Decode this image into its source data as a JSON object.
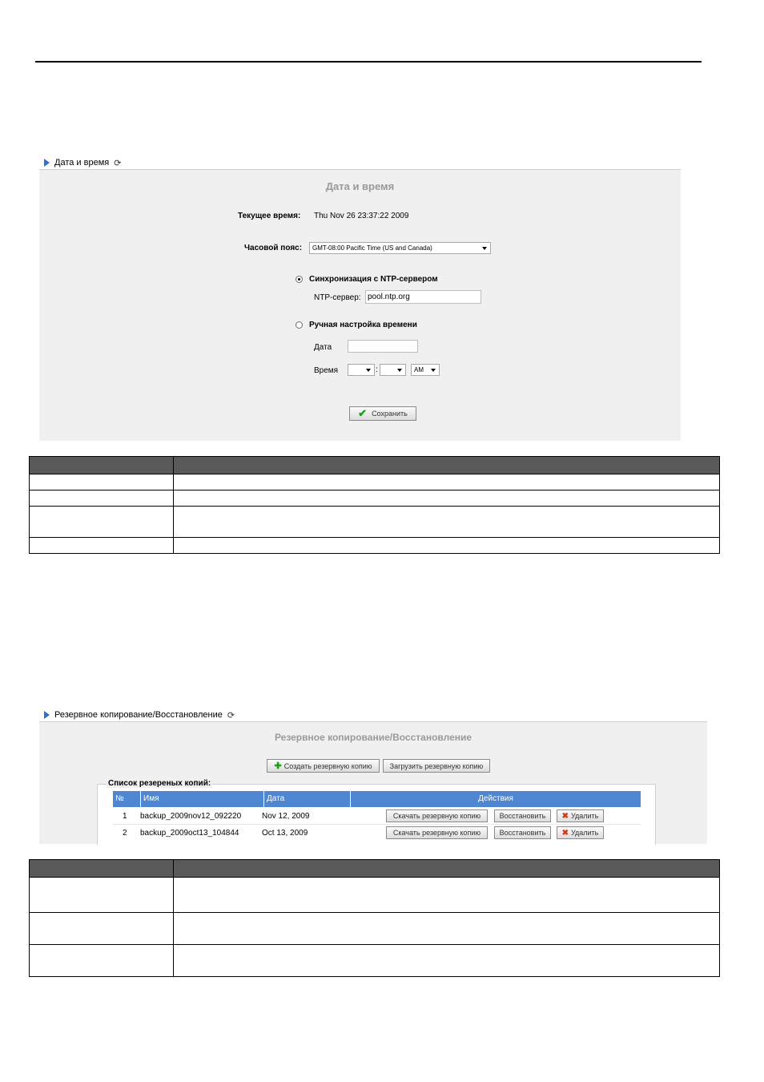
{
  "datetime": {
    "section_title": "Дата и время",
    "panel_title": "Дата и время",
    "current_time_label": "Текущее время:",
    "current_time_value": "Thu Nov 26 23:37:22 2009",
    "timezone_label": "Часовой пояс:",
    "timezone_value": "GMT-08:00 Pacific Time (US and Canada)",
    "ntp_sync_label": "Синхронизация с NTP-сервером",
    "ntp_server_label": "NTP-сервер:",
    "ntp_server_value": "pool.ntp.org",
    "manual_label": "Ручная настройка времени",
    "date_label": "Дата",
    "date_value": "",
    "time_label": "Время",
    "hour_value": "",
    "minute_value": "",
    "time_separator": ":",
    "ampm_value": "AM",
    "save_button": "Сохранить"
  },
  "backup": {
    "section_title": "Резервное копирование/Восстановление",
    "panel_title": "Резервное копирование/Восстановление",
    "create_button": "Создать резервную копию",
    "upload_button": "Загрузить резервную копию",
    "list_legend": "Список резереных копий:",
    "columns": [
      "№",
      "Имя",
      "Дата",
      "Действия"
    ],
    "rows": [
      {
        "num": "1",
        "name": "backup_2009nov12_092220",
        "date": "Nov 12, 2009"
      },
      {
        "num": "2",
        "name": "backup_2009oct13_104844",
        "date": "Oct 13, 2009"
      }
    ],
    "download_button": "Скачать резервную копию",
    "restore_button": "Восстановить",
    "delete_button": "Удалить"
  },
  "icons": [
    "triangle-right-icon",
    "refresh-icon",
    "checkmark-icon",
    "plus-icon",
    "delete-x-icon",
    "chevron-down-icon"
  ],
  "colors": {
    "table_header": "#4e86d1",
    "panel_bg": "#f0f0f0",
    "desc_header": "#595959",
    "accent_triangle": "#2f6fd0"
  }
}
